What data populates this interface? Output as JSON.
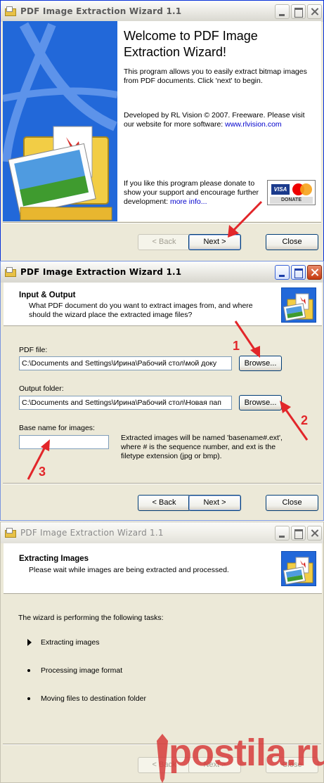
{
  "window1": {
    "title": "PDF Image Extraction Wizard 1.1",
    "heading": "Welcome to PDF Image Extraction Wizard!",
    "intro": "This program allows you to easily extract bitmap images from PDF documents. Click 'next' to begin.",
    "developer_text": "Developed by RL Vision © 2007. Freeware. Please visit our website for more software: ",
    "website_link": "www.rlvision.com",
    "donate_text": "If you like this program please donate to show your support and encourage further development: ",
    "more_info_link": "more info...",
    "donate_badge": {
      "visa": "VISA",
      "label": "DONATE"
    },
    "buttons": {
      "back": "< Back",
      "next": "Next >",
      "close": "Close"
    }
  },
  "window2": {
    "title": "PDF Image Extraction Wizard 1.1",
    "header_title": "Input & Output",
    "header_subtitle": "What PDF document do you want to extract images from, and where should the wizard place the extracted image files?",
    "pdf_file_label": "PDF file:",
    "pdf_file_value": "C:\\Documents and Settings\\Ирина\\Рабочий стол\\мой доку",
    "browse_label": "Browse...",
    "output_folder_label": "Output folder:",
    "output_folder_value": "C:\\Documents and Settings\\Ирина\\Рабочий стол\\Новая пап",
    "base_name_label": "Base name for images:",
    "base_name_value": "",
    "note": "Extracted images will be named 'basename#.ext', where # is the sequence number, and ext is the filetype extension (jpg or bmp).",
    "buttons": {
      "back": "< Back",
      "next": "Next >",
      "close": "Close"
    },
    "annotations": [
      "1",
      "2",
      "3"
    ]
  },
  "window3": {
    "title": "PDF Image Extraction Wizard 1.1",
    "header_title": "Extracting Images",
    "header_subtitle": "Please wait while images are being extracted and processed.",
    "tasks_intro": "The wizard is performing the following tasks:",
    "tasks": [
      "Extracting images",
      "Processing image format",
      "Moving files to destination folder"
    ],
    "buttons": {
      "back": "< Back",
      "next": "Next >",
      "close": "Close"
    }
  },
  "watermark": "postila.ru",
  "colors": {
    "annotation_red": "#e2262a",
    "watermark_red": "#d63434",
    "side_blue": "#2268d9"
  }
}
